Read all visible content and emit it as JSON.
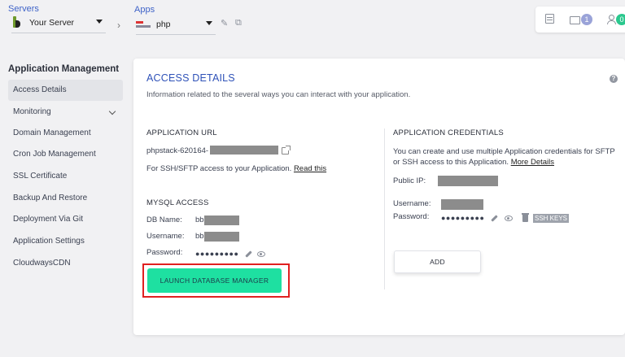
{
  "header": {
    "servers_label": "Servers",
    "server_name": "Your Server",
    "apps_label": "Apps",
    "app_name": "php",
    "folder_count": "1",
    "team_count": "0"
  },
  "sidebar": {
    "title": "Application Management",
    "items": [
      {
        "label": "Access Details",
        "active": true
      },
      {
        "label": "Monitoring"
      },
      {
        "label": "Domain Management"
      },
      {
        "label": "Cron Job Management"
      },
      {
        "label": "SSL Certificate"
      },
      {
        "label": "Backup And Restore"
      },
      {
        "label": "Deployment Via Git"
      },
      {
        "label": "Application Settings"
      },
      {
        "label": "CloudwaysCDN"
      }
    ]
  },
  "main": {
    "title": "ACCESS DETAILS",
    "description": "Information related to the several ways you can interact with your application.",
    "app_url": {
      "heading": "APPLICATION URL",
      "url_prefix": "phpstack-620164-",
      "ssh_note": "For SSH/SFTP access to your Application.",
      "read_this": "Read this"
    },
    "mysql": {
      "heading": "MYSQL ACCESS",
      "db_name_label": "DB Name:",
      "db_name_value": "bb",
      "username_label": "Username:",
      "username_value": "bb",
      "password_label": "Password:",
      "password_mask": "●●●●●●●●●",
      "launch_button": "LAUNCH DATABASE MANAGER"
    },
    "credentials": {
      "heading": "APPLICATION CREDENTIALS",
      "description_line1": "You can create and use multiple Application credentials for SFTP",
      "description_line2": "or SSH access to this Application.",
      "more_details": "More Details",
      "public_ip_label": "Public IP:",
      "username_label": "Username:",
      "password_label": "Password:",
      "password_mask": "●●●●●●●●●",
      "ssh_keys": "SSH KEYS",
      "add_button": "ADD"
    }
  },
  "colors": {
    "accent_blue": "#2f52b8",
    "launch_green": "#1ee0a1",
    "highlight_red": "#e02020"
  }
}
